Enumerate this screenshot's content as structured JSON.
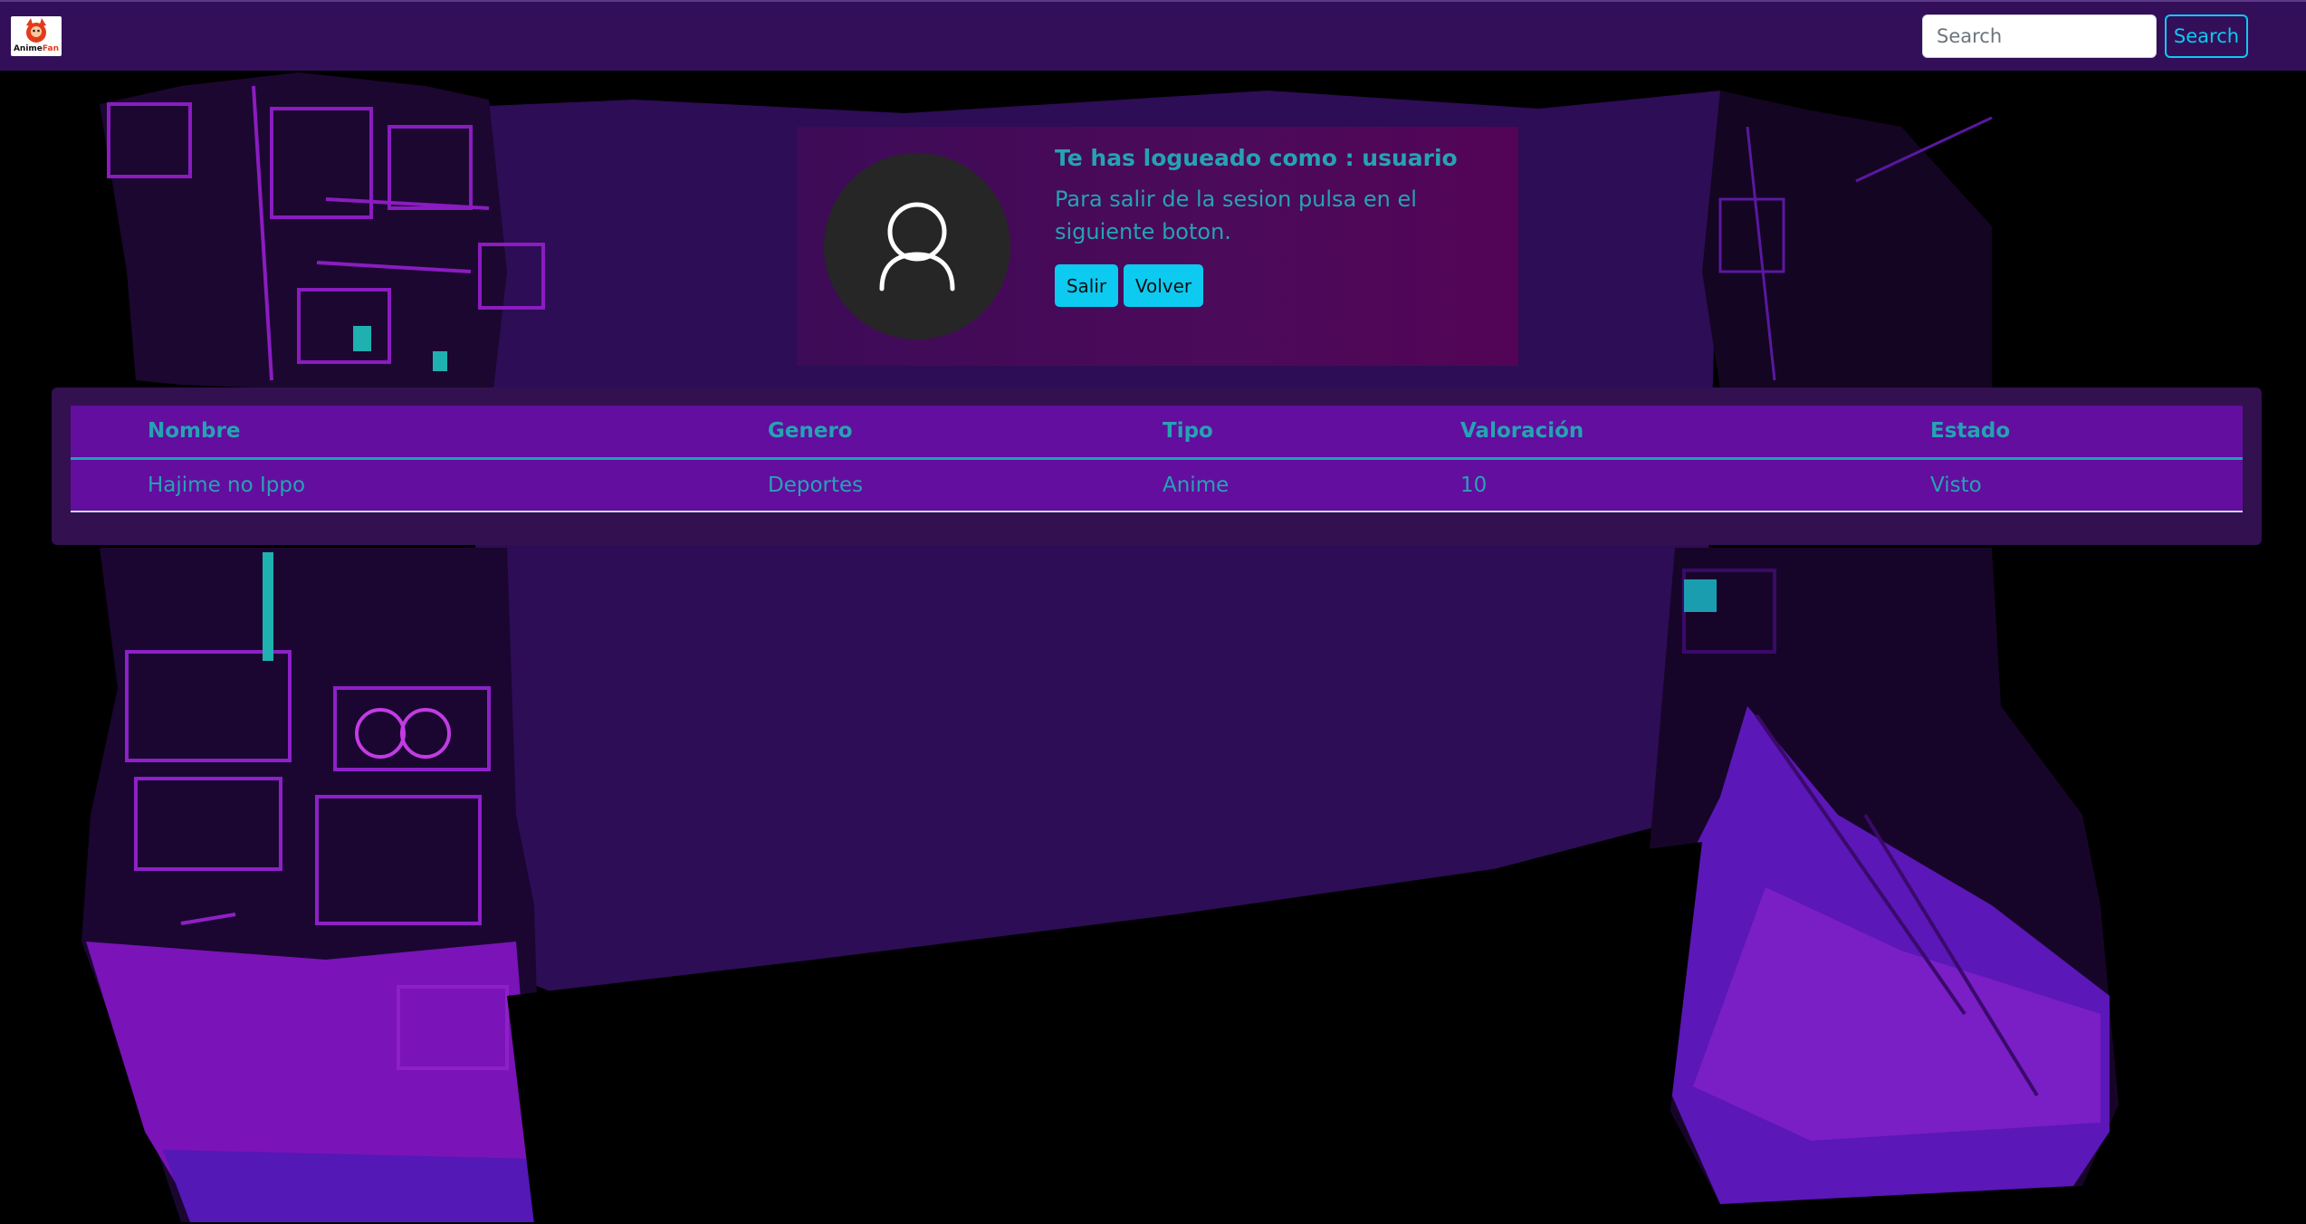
{
  "navbar": {
    "logo_text": "AnimeFan",
    "search_placeholder": "Search",
    "search_button": "Search"
  },
  "profile": {
    "title": "Te has logueado como : usuario",
    "message": "Para salir de la sesion pulsa en el siguiente boton.",
    "salir_button": "Salir",
    "volver_button": "Volver",
    "avatar_icon": "user-icon"
  },
  "table": {
    "headers": [
      "Nombre",
      "Genero",
      "Tipo",
      "Valoración",
      "Estado"
    ],
    "rows": [
      [
        "Hajime no Ippo",
        "Deportes",
        "Anime",
        "10",
        "Visto"
      ]
    ]
  },
  "colors": {
    "navbar": "#330f5a",
    "accent_cyan": "#0dcaf0",
    "text_teal": "#25a3b3",
    "table_bg": "#630e9f",
    "panel_bg": "#33104f"
  }
}
